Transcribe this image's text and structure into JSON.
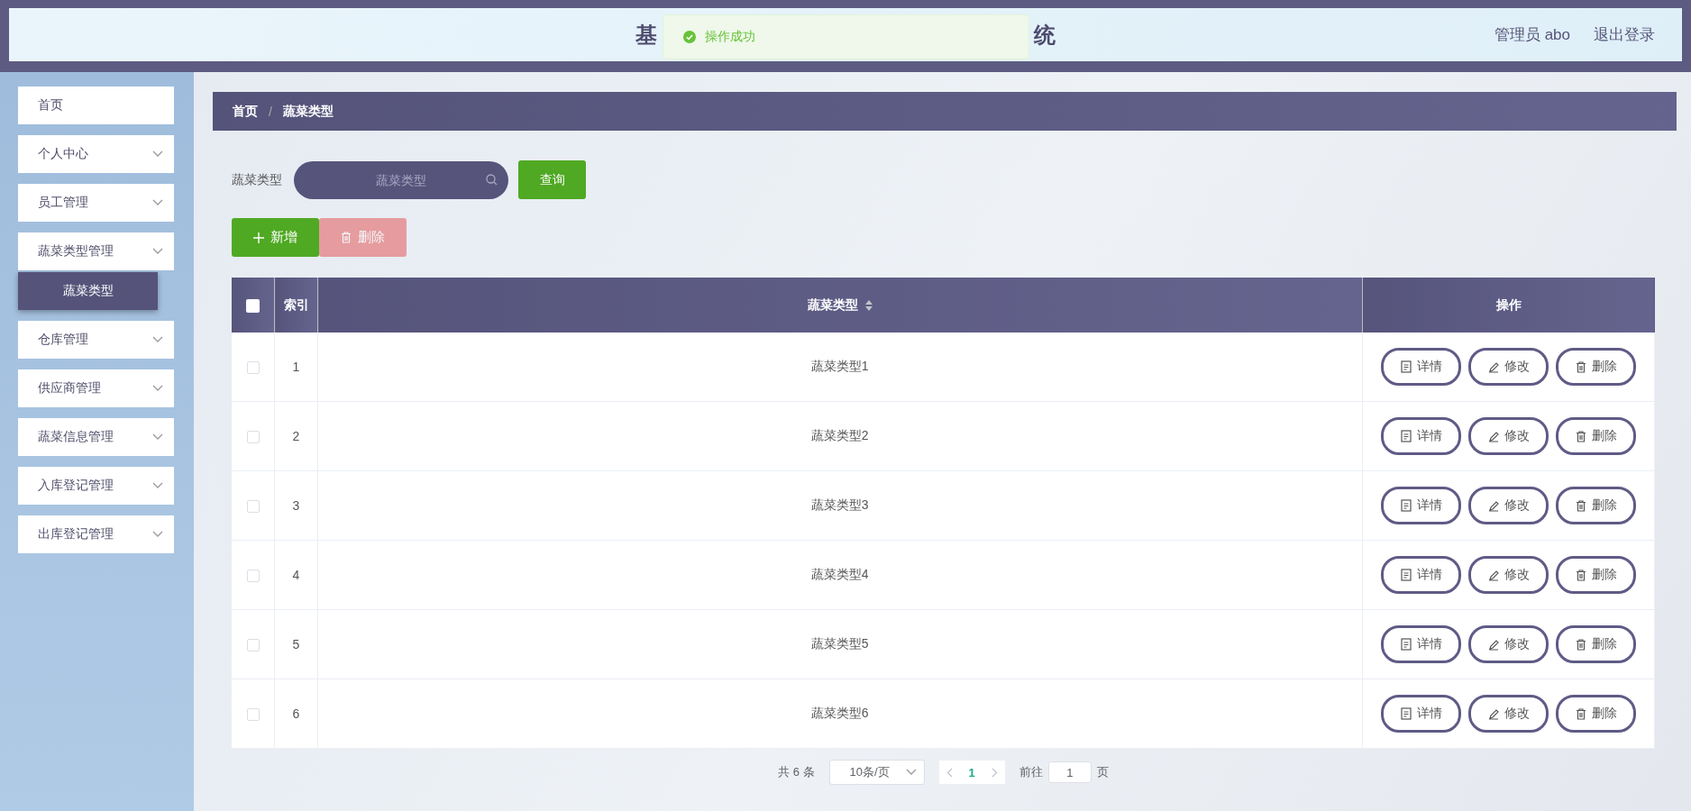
{
  "header": {
    "title_parts": [
      "基",
      "统"
    ],
    "user": "管理员 abo",
    "logout": "退出登录"
  },
  "toast": {
    "message": "操作成功"
  },
  "sidebar": {
    "items": [
      {
        "label": "首页",
        "kind": "link"
      },
      {
        "label": "个人中心",
        "kind": "submenu"
      },
      {
        "label": "员工管理",
        "kind": "submenu"
      },
      {
        "label": "蔬菜类型管理",
        "kind": "submenu",
        "children": [
          {
            "label": "蔬菜类型",
            "selected": true
          }
        ]
      },
      {
        "label": "仓库管理",
        "kind": "submenu"
      },
      {
        "label": "供应商管理",
        "kind": "submenu"
      },
      {
        "label": "蔬菜信息管理",
        "kind": "submenu"
      },
      {
        "label": "入库登记管理",
        "kind": "submenu"
      },
      {
        "label": "出库登记管理",
        "kind": "submenu"
      }
    ]
  },
  "breadcrumb": [
    "首页",
    "蔬菜类型"
  ],
  "breadcrumb_separator": "/",
  "search": {
    "label": "蔬菜类型",
    "placeholder": "蔬菜类型",
    "button": "查询"
  },
  "actions": [
    {
      "label": "新增",
      "kind": "add",
      "disabled": false
    },
    {
      "label": "删除",
      "kind": "delete",
      "disabled": true
    }
  ],
  "table": {
    "columns": [
      "索引",
      "蔬菜类型",
      "操作"
    ],
    "all_checked": false,
    "rows": [
      {
        "index": "1",
        "name": "蔬菜类型1",
        "checked": false,
        "actions": [
          "详情",
          "修改",
          "删除"
        ]
      },
      {
        "index": "2",
        "name": "蔬菜类型2",
        "checked": false,
        "actions": [
          "详情",
          "修改",
          "删除"
        ]
      },
      {
        "index": "3",
        "name": "蔬菜类型3",
        "checked": false,
        "actions": [
          "详情",
          "修改",
          "删除"
        ]
      },
      {
        "index": "4",
        "name": "蔬菜类型4",
        "checked": false,
        "actions": [
          "详情",
          "修改",
          "删除"
        ]
      },
      {
        "index": "5",
        "name": "蔬菜类型5",
        "checked": false,
        "actions": [
          "详情",
          "修改",
          "删除"
        ]
      },
      {
        "index": "6",
        "name": "蔬菜类型6",
        "checked": false,
        "actions": [
          "详情",
          "修改",
          "删除"
        ]
      }
    ]
  },
  "pagination": {
    "total": "共 6 条",
    "page_size": "10条/页",
    "pages": [
      {
        "label": "1",
        "selected": true
      }
    ],
    "goto_label": "前往",
    "goto_value": "1",
    "goto_suffix": "页"
  }
}
